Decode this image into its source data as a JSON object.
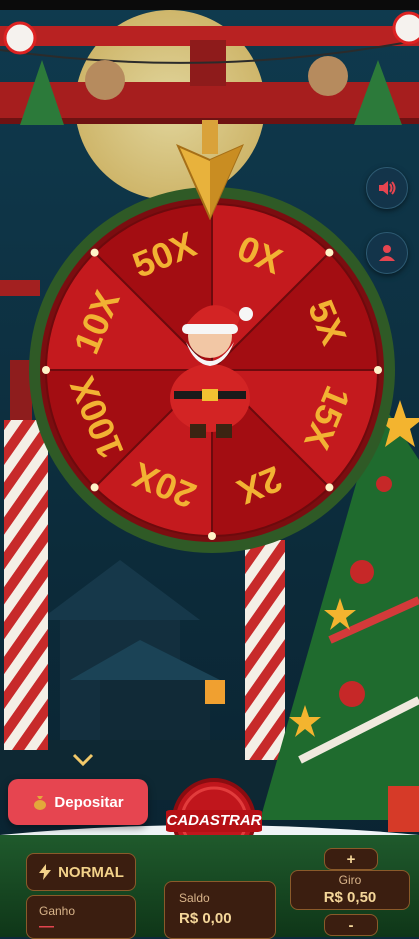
{
  "wheel": {
    "segments": [
      "0X",
      "5X",
      "15X",
      "2X",
      "20X",
      "100X",
      "10X",
      "50X"
    ],
    "colors": {
      "segment_dark": "#a30d12",
      "segment_light": "#c41a1e",
      "text": "#f2b233",
      "rim": "#2f5a26"
    }
  },
  "icons": {
    "sound": "speaker-icon",
    "profile": "user-icon",
    "scroll": "chevron-down-icon",
    "money": "money-bag-icon",
    "lightning": "lightning-icon"
  },
  "actions": {
    "deposit_label": "Depositar",
    "register_label": "CADASTRAR"
  },
  "controls": {
    "mode_label": "NORMAL",
    "win_label": "Ganho",
    "win_value": "—",
    "balance_label": "Saldo",
    "balance_value": "R$ 0,00",
    "bet_label": "Giro",
    "bet_value": "R$ 0,50",
    "plus_label": "+",
    "minus_label": "-"
  }
}
